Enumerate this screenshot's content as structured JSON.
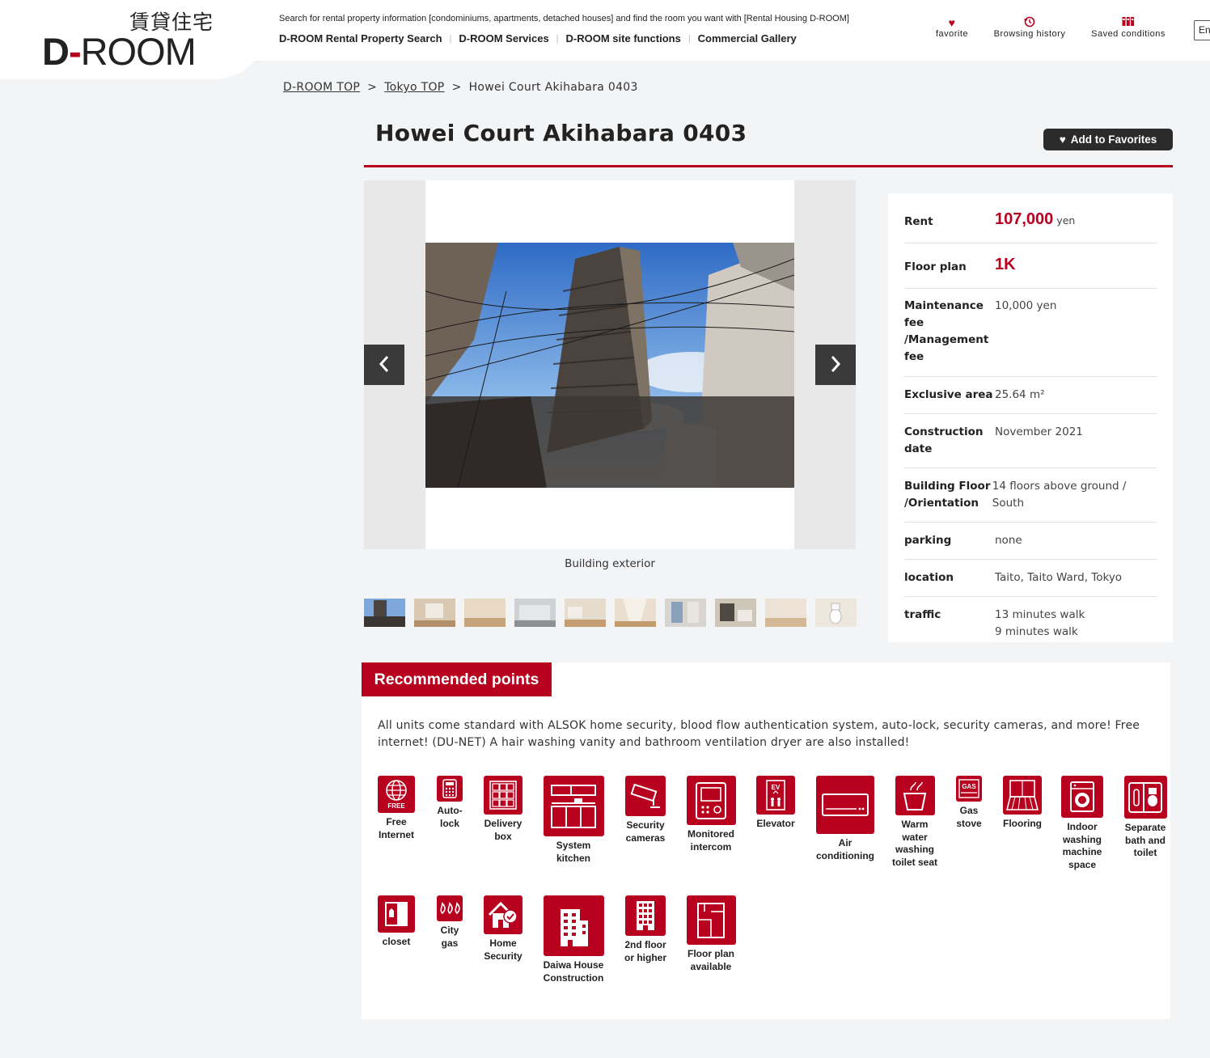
{
  "header": {
    "logo_jp": "賃貸住宅",
    "logo_d": "D",
    "logo_dash": "-",
    "logo_room": "ROOM",
    "tagline": "Search for rental property information [condominiums, apartments, detached houses] and find the room you want with [Rental Housing D-ROOM]",
    "nav": [
      "D-ROOM Rental Property Search",
      "D-ROOM Services",
      "D-ROOM site functions",
      "Commercial Gallery"
    ],
    "icons": [
      {
        "label": "favorite",
        "icon": "heart-icon"
      },
      {
        "label": "Browsing history",
        "icon": "history-icon"
      },
      {
        "label": "Saved conditions",
        "icon": "folder-icon"
      }
    ],
    "lang": "En"
  },
  "breadcrumb": [
    "D-ROOM TOP",
    "Tokyo TOP",
    "Howei Court Akihabara 0403"
  ],
  "property": {
    "title": "Howei Court Akihabara 0403",
    "add_favorites": "Add to Favorites"
  },
  "gallery": {
    "caption": "Building exterior",
    "thumb_count": 10
  },
  "info": {
    "rent_label": "Rent",
    "rent_value": "107,000",
    "rent_unit": "yen",
    "floor_plan_label": "Floor plan",
    "floor_plan_value": "1K",
    "maint_label": "Maintenance fee /Management fee",
    "maint_value": "10,000 yen",
    "area_label": "Exclusive area",
    "area_value": "25.64 m²",
    "construction_label": "Construction date",
    "construction_value": "November 2021",
    "building_label": "Building Floor /Orientation",
    "building_value": "14 floors above ground / South",
    "parking_label": "parking",
    "parking_value": "none",
    "location_label": "location",
    "location_value": "Taito, Taito Ward, Tokyo",
    "traffic_label": "traffic",
    "traffic_value_1": "13 minutes walk",
    "traffic_value_2": "9 minutes walk"
  },
  "recommended": {
    "heading": "Recommended points",
    "text": "All units come standard with ALSOK home security, blood flow authentication system, auto-lock, security cameras, and more! Free internet! (DU-NET) A hair washing vanity and bathroom ventilation dryer are also installed!",
    "features": [
      {
        "label": "Free Internet",
        "icon": "globe-icon",
        "badge": "FREE"
      },
      {
        "label": "Auto-lock",
        "icon": "keypad-icon"
      },
      {
        "label": "Delivery box",
        "icon": "locker-icon"
      },
      {
        "label": "System kitchen",
        "icon": "kitchen-icon"
      },
      {
        "label": "Security cameras",
        "icon": "camera-icon"
      },
      {
        "label": "Monitored intercom",
        "icon": "intercom-icon"
      },
      {
        "label": "Elevator",
        "icon": "elevator-icon",
        "badge": "EV"
      },
      {
        "label": "Air conditioning",
        "icon": "aircon-icon"
      },
      {
        "label": "Warm water washing toilet seat",
        "icon": "toilet-seat-icon"
      },
      {
        "label": "Gas stove",
        "icon": "gas-stove-icon",
        "badge": "GAS"
      },
      {
        "label": "Flooring",
        "icon": "flooring-icon"
      },
      {
        "label": "Indoor washing machine space",
        "icon": "washing-machine-icon"
      },
      {
        "label": "Separate bath and toilet",
        "icon": "bath-toilet-icon"
      },
      {
        "label": "closet",
        "icon": "closet-icon"
      },
      {
        "label": "City gas",
        "icon": "flame-icon"
      },
      {
        "label": "Home Security",
        "icon": "home-check-icon"
      },
      {
        "label": "Daiwa House Construction",
        "icon": "building-icon"
      },
      {
        "label": "2nd floor or higher",
        "icon": "tall-building-icon"
      },
      {
        "label": "Floor plan available",
        "icon": "floor-plan-icon"
      }
    ]
  },
  "colors": {
    "accent": "#b8001f",
    "dark": "#2b2b2b"
  }
}
